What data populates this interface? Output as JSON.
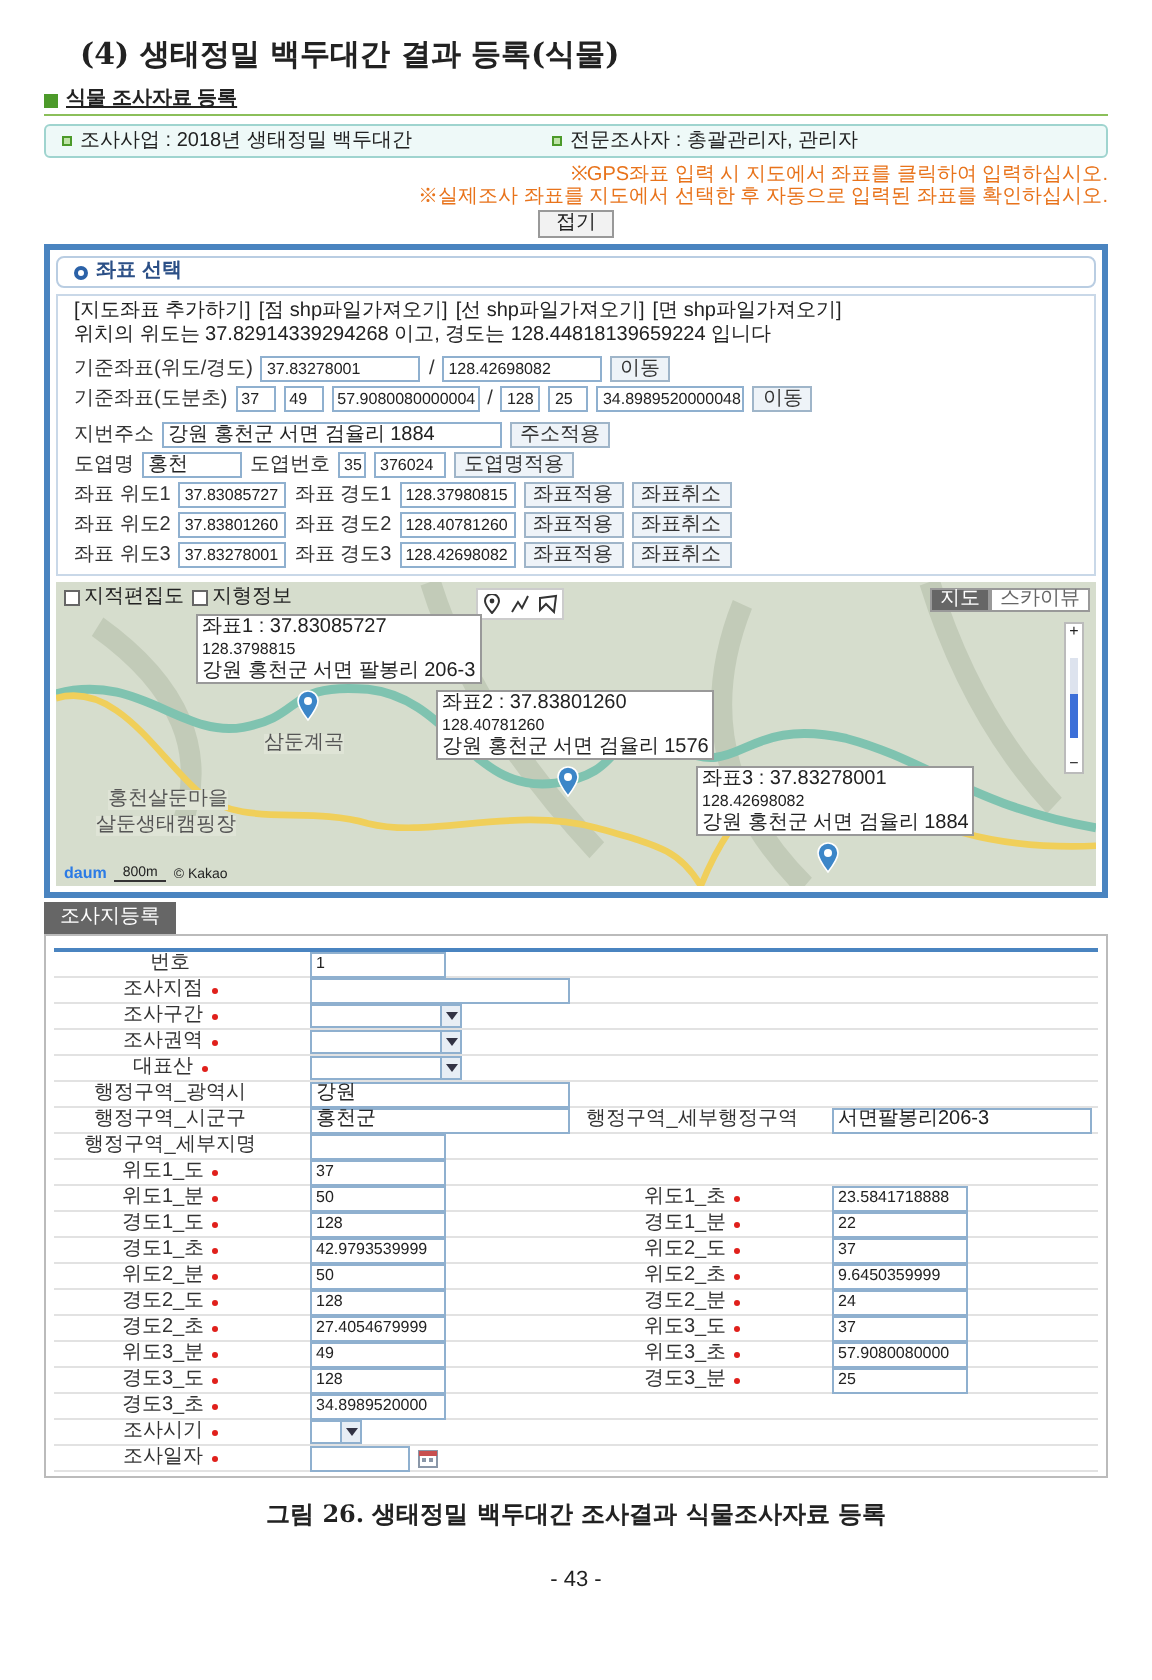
{
  "heading": "(4) 생태정밀 백두대간 결과 등록(식물)",
  "section_title": "식물 조사자료 등록",
  "info": [
    "조사사업 : 2018년 생태정밀 백두대간",
    "전문조사자 : 총괄관리자, 관리자"
  ],
  "notes": [
    "※GPS좌표 입력 시 지도에서 좌표를 클릭하여 입력하십시오.",
    "※실제조사 좌표를 지도에서 선택한 후 자동으로 입력된 좌표를 확인하십시오."
  ],
  "collapse_button": "접기",
  "coord_panel": {
    "title": "좌표 선택",
    "links": [
      "[지도좌표 추가하기]",
      "[점 shp파일가져오기]",
      "[선 shp파일가져오기]",
      "[면 shp파일가져오기]"
    ],
    "position_text": "위치의 위도는 37.82914339294268 이고, 경도는 128.44818139659224 입니다",
    "base_decimal": {
      "label": "기준좌표(위도/경도)",
      "lat": "37.83278001",
      "sep": "/",
      "lon": "128.42698082",
      "button": "이동"
    },
    "base_dms": {
      "label": "기준좌표(도분초)",
      "lat": [
        "37",
        "49",
        "57.9080080000004"
      ],
      "sep": "/",
      "lon": [
        "128",
        "25",
        "34.8989520000048"
      ],
      "button": "이동"
    },
    "address": {
      "label": "지번주소",
      "value": "강원 홍천군 서면 검율리 1884",
      "button": "주소적용"
    },
    "map_sheet": {
      "label": "도엽명",
      "value": "홍천",
      "number_label": "도엽번호",
      "number_parts": [
        "35",
        "376024"
      ],
      "button": "도엽명적용"
    },
    "points": [
      {
        "lat_label": "좌표 위도1",
        "lat": "37.83085727",
        "lon_label": "좌표 경도1",
        "lon": "128.37980815",
        "apply": "좌표적용",
        "cancel": "좌표취소"
      },
      {
        "lat_label": "좌표 위도2",
        "lat": "37.83801260",
        "lon_label": "좌표 경도2",
        "lon": "128.40781260",
        "apply": "좌표적용",
        "cancel": "좌표취소"
      },
      {
        "lat_label": "좌표 위도3",
        "lat": "37.83278001",
        "lon_label": "좌표 경도3",
        "lon": "128.42698082",
        "apply": "좌표적용",
        "cancel": "좌표취소"
      }
    ]
  },
  "map": {
    "layers": [
      {
        "label": "지적편집도",
        "checked": false
      },
      {
        "label": "지형정보",
        "checked": false
      }
    ],
    "views": [
      {
        "label": "지도",
        "selected": true
      },
      {
        "label": "스카이뷰",
        "selected": false
      }
    ],
    "zoom_in": "+",
    "zoom_out": "−",
    "zoom": {
      "level": 0.55
    },
    "places": [
      "삼둔계곡",
      "홍천살둔마을",
      "살둔생태캠핑장"
    ],
    "markers": [
      {
        "lines": [
          "좌표1 : 37.83085727",
          "128.3798815",
          "강원 홍천군 서면 팔봉리 206-3"
        ]
      },
      {
        "lines": [
          "좌표2 : 37.83801260",
          "128.40781260",
          "강원 홍천군 서면 검율리 1576"
        ]
      },
      {
        "lines": [
          "좌표3 : 37.83278001",
          "128.42698082",
          "강원 홍천군 서면 검율리 1884"
        ]
      }
    ],
    "logo": "daum",
    "scale": "800m",
    "attribution": "© Kakao"
  },
  "tab": "조사지등록",
  "form": [
    [
      {
        "label": "번호",
        "required": false,
        "kind": "text",
        "value": "1"
      }
    ],
    [
      {
        "label": "조사지점",
        "required": true,
        "kind": "wide"
      }
    ],
    [
      {
        "label": "조사구간",
        "required": true,
        "kind": "select"
      }
    ],
    [
      {
        "label": "조사권역",
        "required": true,
        "kind": "select"
      }
    ],
    [
      {
        "label": "대표산",
        "required": true,
        "kind": "select"
      }
    ],
    [
      {
        "label": "행정구역_광역시",
        "required": false,
        "kind": "wide",
        "value": "강원"
      }
    ],
    [
      {
        "label": "행정구역_시군구",
        "required": false,
        "kind": "wide",
        "value": "홍천군"
      },
      {
        "label": "행정구역_세부행정구역",
        "required": false,
        "kind": "wide",
        "value": "서면팔봉리206-3"
      }
    ],
    [
      {
        "label": "행정구역_세부지명",
        "required": false,
        "kind": "text"
      }
    ],
    [
      {
        "label": "위도1_도",
        "required": true,
        "kind": "text",
        "value": "37"
      }
    ],
    [
      {
        "label": "위도1_분",
        "required": true,
        "kind": "text",
        "value": "50"
      },
      {
        "label": "위도1_초",
        "required": true,
        "kind": "text",
        "value": "23.5841718888"
      }
    ],
    [
      {
        "label": "경도1_도",
        "required": true,
        "kind": "text",
        "value": "128"
      },
      {
        "label": "경도1_분",
        "required": true,
        "kind": "text",
        "value": "22"
      }
    ],
    [
      {
        "label": "경도1_초",
        "required": true,
        "kind": "text",
        "value": "42.9793539999"
      },
      {
        "label": "위도2_도",
        "required": true,
        "kind": "text",
        "value": "37"
      }
    ],
    [
      {
        "label": "위도2_분",
        "required": true,
        "kind": "text",
        "value": "50"
      },
      {
        "label": "위도2_초",
        "required": true,
        "kind": "text",
        "value": "9.6450359999"
      }
    ],
    [
      {
        "label": "경도2_도",
        "required": true,
        "kind": "text",
        "value": "128"
      },
      {
        "label": "경도2_분",
        "required": true,
        "kind": "text",
        "value": "24"
      }
    ],
    [
      {
        "label": "경도2_초",
        "required": true,
        "kind": "text",
        "value": "27.4054679999"
      },
      {
        "label": "위도3_도",
        "required": true,
        "kind": "text",
        "value": "37"
      }
    ],
    [
      {
        "label": "위도3_분",
        "required": true,
        "kind": "text",
        "value": "49"
      },
      {
        "label": "위도3_초",
        "required": true,
        "kind": "text",
        "value": "57.9080080000"
      }
    ],
    [
      {
        "label": "경도3_도",
        "required": true,
        "kind": "text",
        "value": "128"
      },
      {
        "label": "경도3_분",
        "required": true,
        "kind": "text",
        "value": "25"
      }
    ],
    [
      {
        "label": "경도3_초",
        "required": true,
        "kind": "text",
        "value": "34.8989520000"
      }
    ],
    [
      {
        "label": "조사시기",
        "required": true,
        "kind": "small_select"
      }
    ],
    [
      {
        "label": "조사일자",
        "required": true,
        "kind": "date"
      }
    ]
  ],
  "caption": "그림 26. 생태정밀 백두대간 조사결과 식물조사자료 등록",
  "page_number": "- 43 -"
}
